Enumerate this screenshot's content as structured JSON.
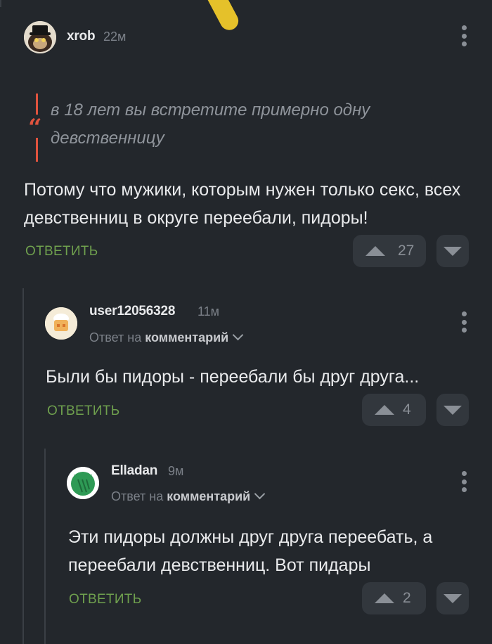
{
  "comments": [
    {
      "username": "xrob",
      "time": "22м",
      "quote": "в 18 лет вы встретите примерно одну девственницу",
      "text": "Потому что мужики, которым нужен только секс, всех девственниц в округе переебали, пидоры!",
      "reply_label": "ОТВЕТИТЬ",
      "votes": "27"
    },
    {
      "username": "user12056328",
      "time": "11м",
      "reply_to_prefix": "Ответ на",
      "reply_to_target": "комментарий",
      "text": "Были бы пидоры - переебали бы друг друга...",
      "reply_label": "ОТВЕТИТЬ",
      "votes": "4"
    },
    {
      "username": "Elladan",
      "time": "9м",
      "reply_to_prefix": "Ответ на",
      "reply_to_target": "комментарий",
      "text": "Эти пидоры должны друг друга переебать, а переебали девственниц. Вот пидары",
      "reply_label": "ОТВЕТИТЬ",
      "votes": "2"
    }
  ],
  "colors": {
    "background": "#23272c",
    "accent_reply": "#6fa04e",
    "quote_accent": "#e0533e",
    "button_bg": "#32373d"
  },
  "icons": [
    "more-vertical-icon",
    "upvote-arrow-icon",
    "downvote-arrow-icon",
    "chevron-down-icon",
    "quote-icon"
  ]
}
